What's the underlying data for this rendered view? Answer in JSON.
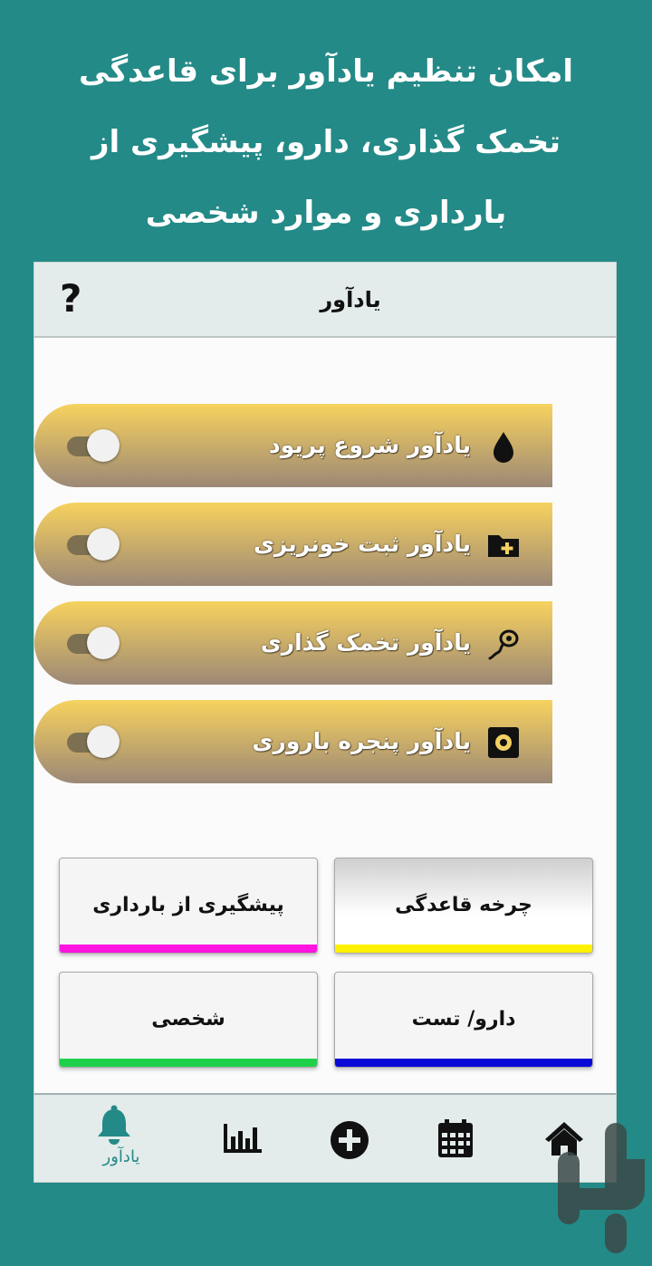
{
  "promo": {
    "lines": [
      "امکان تنظیم یادآور برای قاعدگی",
      "تخمک گذاری، دارو، پیشگیری از",
      "بارداری و موارد شخصی"
    ]
  },
  "appbar": {
    "title": "یادآور",
    "help_glyph": "?"
  },
  "reminders": [
    {
      "label": "یادآور شروع پریود",
      "icon": "drop-icon",
      "enabled": false
    },
    {
      "label": "یادآور ثبت خونریزی",
      "icon": "folder-plus-icon",
      "enabled": false
    },
    {
      "label": "یادآور تخمک گذاری",
      "icon": "sperm-icon",
      "enabled": false
    },
    {
      "label": "یادآور پنجره باروری",
      "icon": "target-icon",
      "enabled": false
    }
  ],
  "categories": [
    {
      "label": "چرخه قاعدگی",
      "bar_color": "#fff200",
      "active": true
    },
    {
      "label": "پیشگیری از بارداری",
      "bar_color": "#ff14e0",
      "active": false
    },
    {
      "label": "دارو/ تست",
      "bar_color": "#0a0ad6",
      "active": false
    },
    {
      "label": "شخصی",
      "bar_color": "#1fd14a",
      "active": false
    }
  ],
  "bottom_nav": {
    "items": [
      {
        "name": "reminder",
        "label": "یادآور",
        "icon": "bell-icon",
        "active": true
      },
      {
        "name": "chart",
        "label": "",
        "icon": "bar-chart-icon",
        "active": false
      },
      {
        "name": "add",
        "label": "",
        "icon": "plus-circle-icon",
        "active": false
      },
      {
        "name": "calendar",
        "label": "",
        "icon": "calendar-icon",
        "active": false
      },
      {
        "name": "home",
        "label": "",
        "icon": "home-icon",
        "active": false
      }
    ]
  },
  "colors": {
    "background": "#238a87",
    "accent": "#238a87",
    "reminder_gradient_top": "#f7d25e",
    "reminder_gradient_bottom": "#9c8876"
  }
}
